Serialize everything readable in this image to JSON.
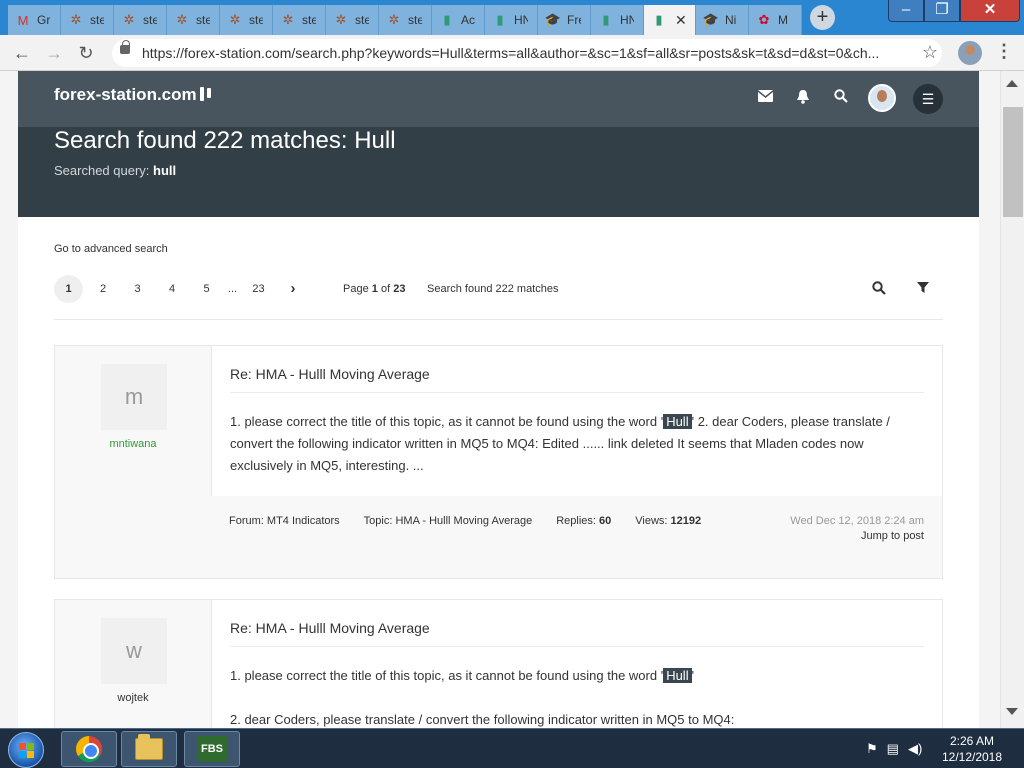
{
  "browser": {
    "tabs": [
      {
        "icon": "gmail-icon",
        "glyph": "M",
        "title": "Gr",
        "color": "#d93025"
      },
      {
        "icon": "spider-icon",
        "glyph": "✲",
        "title": "ste",
        "color": "#a0522d"
      },
      {
        "icon": "spider-icon",
        "glyph": "✲",
        "title": "ste",
        "color": "#a0522d"
      },
      {
        "icon": "spider-icon",
        "glyph": "✲",
        "title": "ste",
        "color": "#a0522d"
      },
      {
        "icon": "spider-icon",
        "glyph": "✲",
        "title": "ste",
        "color": "#a0522d"
      },
      {
        "icon": "spider-icon",
        "glyph": "✲",
        "title": "ste",
        "color": "#a0522d"
      },
      {
        "icon": "spider-icon",
        "glyph": "✲",
        "title": "ste",
        "color": "#a0522d"
      },
      {
        "icon": "spider-icon",
        "glyph": "✲",
        "title": "ste",
        "color": "#a0522d"
      },
      {
        "icon": "candle-icon",
        "glyph": "▮",
        "title": "Ac",
        "color": "#2e9a76"
      },
      {
        "icon": "candle-icon",
        "glyph": "▮",
        "title": "HN",
        "color": "#2e9a76"
      },
      {
        "icon": "cap-icon",
        "glyph": "🎓",
        "title": "Fre",
        "color": "#1a3a6a"
      },
      {
        "icon": "candle-icon",
        "glyph": "▮",
        "title": "HN",
        "color": "#2e9a76"
      },
      {
        "icon": "candle-icon",
        "glyph": "▮",
        "title": "",
        "color": "#2e9a76"
      },
      {
        "icon": "cap-icon",
        "glyph": "🎓",
        "title": "Ni",
        "color": "#1a3a6a"
      },
      {
        "icon": "huawei-icon",
        "glyph": "✿",
        "title": "M",
        "color": "#cf0a2c"
      }
    ],
    "url": "https://forex-station.com/search.php?keywords=Hull&terms=all&author=&sc=1&sf=all&sr=posts&sk=t&sd=d&st=0&ch..."
  },
  "site": {
    "logo": "forex-station.com",
    "heading": "Search found 222 matches: Hull",
    "query_label": "Searched query:",
    "query_value": "hull",
    "advanced_link": "Go to advanced search",
    "pages": [
      "1",
      "2",
      "3",
      "4",
      "5",
      "...",
      "23"
    ],
    "page_word": "Page",
    "page_current": "1",
    "page_of": "of",
    "page_total": "23",
    "matches_text": "Search found 222 matches"
  },
  "posts": [
    {
      "avatar_letter": "m",
      "username": "mntiwana",
      "username_color": "#2e9a36",
      "title": "Re: HMA - Hulll Moving Average",
      "text_before": "1. please correct the title of this topic, as it cannot be found using the word '",
      "highlight": "Hull",
      "text_after": "' 2. dear Coders, please translate / convert the following indicator written in MQ5 to MQ4: Edited ...... link deleted It seems that Mladen codes now exclusively in MQ5, interesting. ...",
      "forum_label": "Forum:",
      "forum": "MT4 Indicators",
      "topic_label": "Topic:",
      "topic": "HMA - Hulll Moving Average",
      "replies_label": "Replies:",
      "replies": "60",
      "views_label": "Views:",
      "views": "12192",
      "date": "Wed Dec 12, 2018 2:24 am",
      "jump": "Jump to post"
    },
    {
      "avatar_letter": "w",
      "username": "wojtek",
      "username_color": "#333333",
      "title": "Re: HMA - Hulll Moving Average",
      "text_before": "1. please correct the title of this topic, as it cannot be found using the word '",
      "highlight": "Hull",
      "text_after": "'",
      "text_2": "2. dear Coders, please translate / convert the following indicator written in MQ5 to MQ4:"
    }
  ],
  "taskbar": {
    "fbs_label": "FBS",
    "time": "2:26 AM",
    "date": "12/12/2018"
  }
}
